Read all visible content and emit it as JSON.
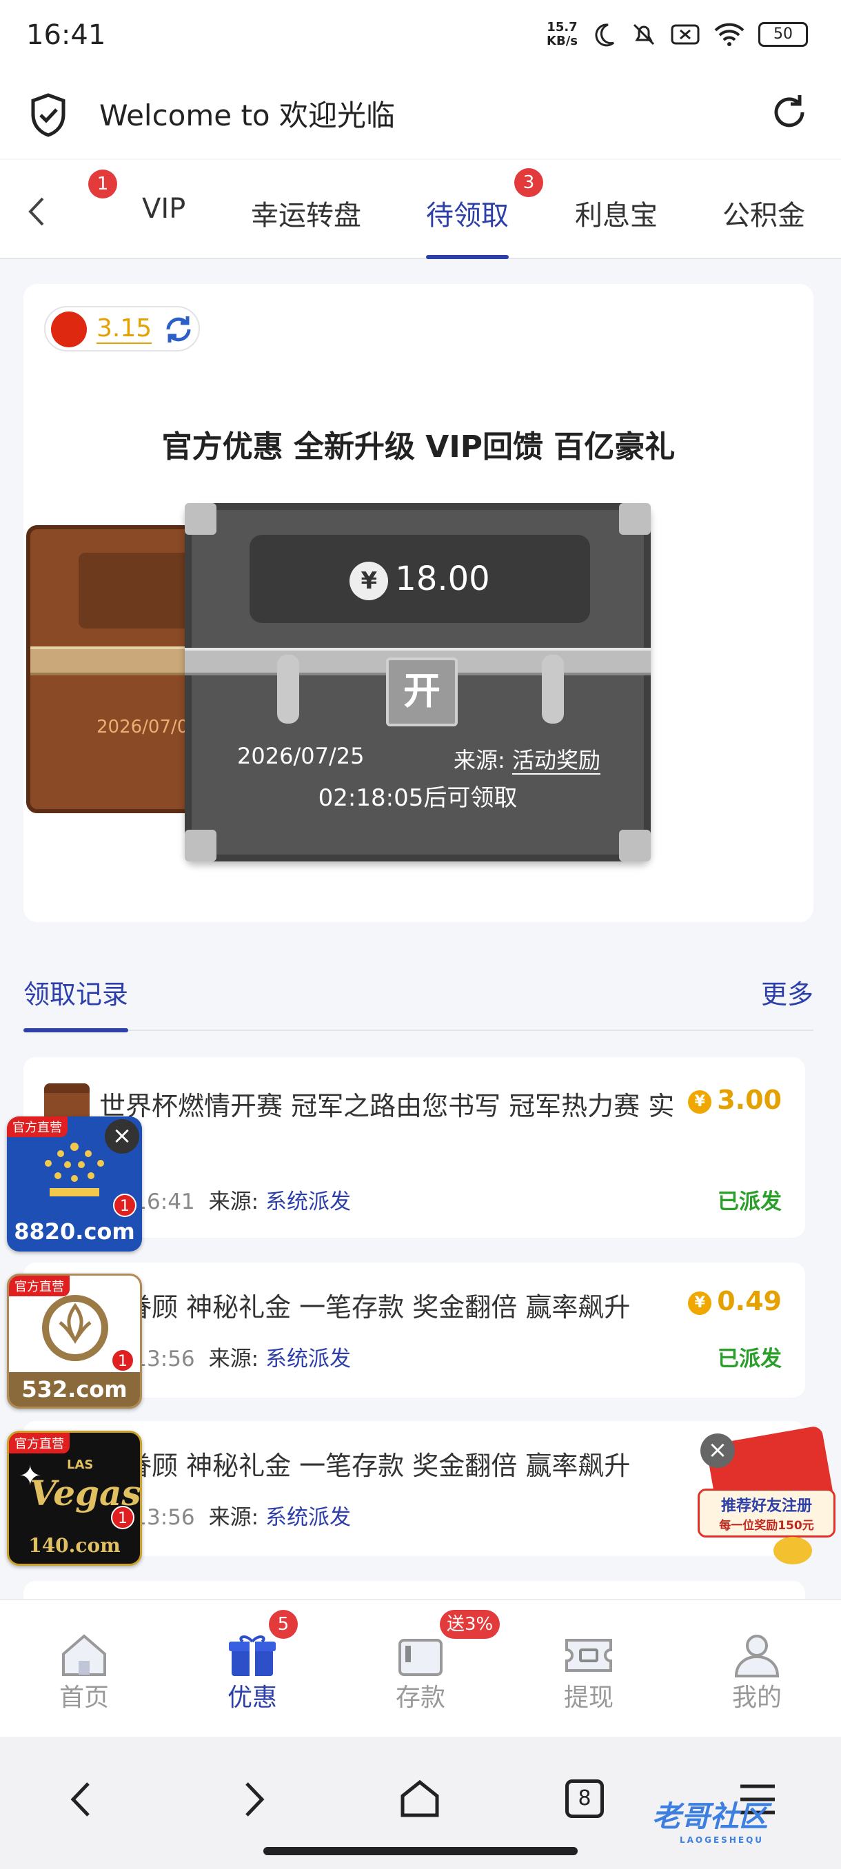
{
  "status_bar": {
    "time": "16:41",
    "net_speed_value": "15.7",
    "net_speed_unit": "KB/s",
    "battery": "50"
  },
  "url_bar": {
    "title": "Welcome to 欢迎光临"
  },
  "tabs": [
    {
      "label": "VIP",
      "badge": "1"
    },
    {
      "label": "幸运转盘"
    },
    {
      "label": "待领取",
      "badge": "3",
      "active": true
    },
    {
      "label": "利息宝"
    },
    {
      "label": "公积金"
    }
  ],
  "card": {
    "version": "3.15",
    "headline": "官方优惠 全新升级 VIP回馈 百亿豪礼",
    "back_chest_date": "2026/07/03",
    "chest": {
      "currency": "¥",
      "amount": "18.00",
      "lock_label": "开",
      "date": "2026/07/25",
      "source_label": "来源:",
      "source_value": "活动奖励",
      "countdown": "02:18:05后可领取"
    }
  },
  "records": {
    "title": "领取记录",
    "more": "更多",
    "items": [
      {
        "title": "世界杯燃情开赛 冠军之路由您书写 冠军热力赛 实",
        "currency": "¥",
        "amount": "3.00",
        "time": "25 16:41",
        "source_label": "来源:",
        "source": "系统派发",
        "status": "已派发"
      },
      {
        "title": "神眷顾 神秘礼金 一笔存款 奖金翻倍 赢率飙升",
        "currency": "¥",
        "amount": "0.49",
        "time": "19 13:56",
        "source_label": "来源:",
        "source": "系统派发",
        "status": "已派发"
      },
      {
        "title": "神眷顾 神秘礼金 一笔存款 奖金翻倍 赢率飙升",
        "time": "19 13:56",
        "source_label": "来源:",
        "source": "系统派发"
      }
    ]
  },
  "ads": [
    {
      "tag": "官方直营",
      "domain": "8820.com",
      "count": "1",
      "color": "#1e4fb5"
    },
    {
      "tag": "官方直营",
      "domain": "532.com",
      "count": "1",
      "color": "#8a6a3a"
    },
    {
      "tag": "官方直营",
      "domain": "140.com",
      "brand": "Vegas",
      "brand_small": "LAS",
      "count": "1",
      "color": "#111111"
    }
  ],
  "refer_ad": {
    "line1": "推荐好友注册",
    "line2": "每一位奖励150元"
  },
  "bottom_nav": [
    {
      "label": "首页",
      "icon": "home-icon"
    },
    {
      "label": "优惠",
      "icon": "gift-icon",
      "badge": "5",
      "active": true
    },
    {
      "label": "存款",
      "icon": "wallet-icon",
      "badge": "送3%"
    },
    {
      "label": "提现",
      "icon": "withdraw-icon"
    },
    {
      "label": "我的",
      "icon": "user-icon"
    }
  ],
  "system_nav": {
    "tabs_count": "8"
  },
  "watermark": {
    "text": "老哥社区",
    "sub": "LAOGESHEQU"
  },
  "colors": {
    "accent": "#2d3fa8",
    "badge": "#e33b3b",
    "gold": "#e5a100",
    "green": "#2aa02a"
  }
}
